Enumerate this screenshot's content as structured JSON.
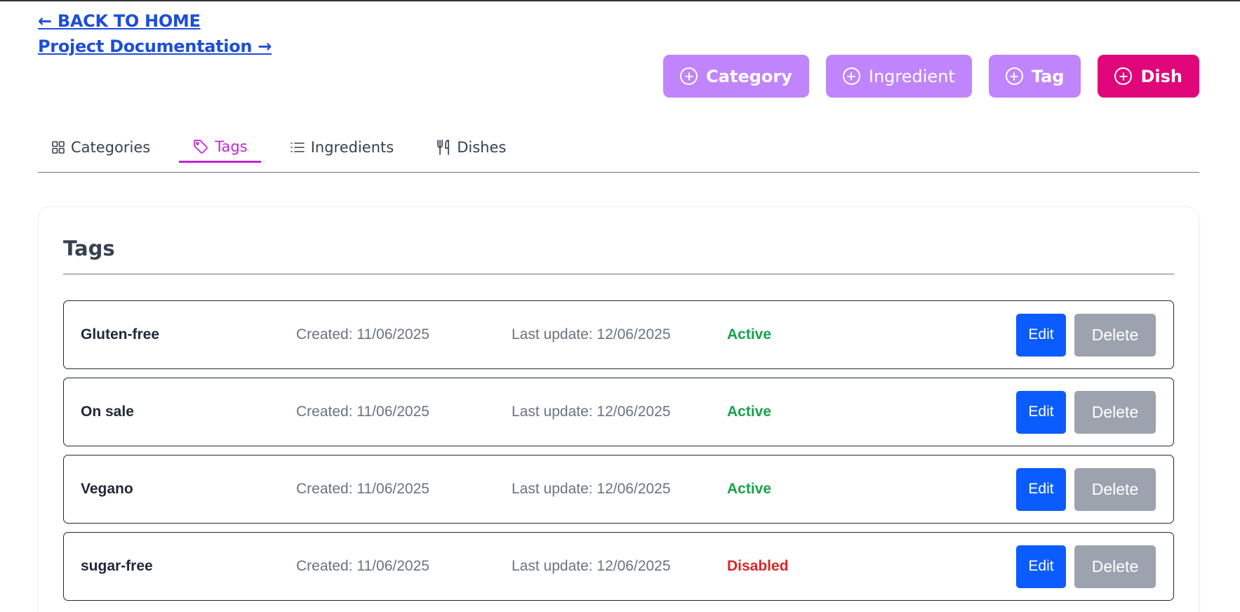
{
  "nav": {
    "back_home": "← BACK TO HOME",
    "project_docs": "Project Documentation →"
  },
  "actions": [
    {
      "label": "Category",
      "icon": "plus-circle-icon"
    },
    {
      "label": "Ingredient",
      "icon": "plus-circle-icon"
    },
    {
      "label": "Tag",
      "icon": "plus-circle-icon"
    },
    {
      "label": "Dish",
      "icon": "plus-circle-icon"
    }
  ],
  "tabs": [
    {
      "label": "Categories",
      "icon": "grid-icon"
    },
    {
      "label": "Tags",
      "icon": "tag-icon",
      "active": true
    },
    {
      "label": "Ingredients",
      "icon": "list-icon"
    },
    {
      "label": "Dishes",
      "icon": "utensils-icon"
    }
  ],
  "section": {
    "title": "Tags"
  },
  "tags": [
    {
      "name": "Gluten-free",
      "created": "Created: 11/06/2025",
      "updated": "Last update: 12/06/2025",
      "status": "Active"
    },
    {
      "name": "On sale",
      "created": "Created: 11/06/2025",
      "updated": "Last update: 12/06/2025",
      "status": "Active"
    },
    {
      "name": "Vegano",
      "created": "Created: 11/06/2025",
      "updated": "Last update: 12/06/2025",
      "status": "Active"
    },
    {
      "name": "sugar-free",
      "created": "Created: 11/06/2025",
      "updated": "Last update: 12/06/2025",
      "status": "Disabled"
    }
  ],
  "row_buttons": {
    "edit": "Edit",
    "delete": "Delete"
  },
  "colors": {
    "accent": "#c084fc",
    "dish_button": "#e0067a",
    "active_tab": "#c026d3",
    "edit_button": "#0b5cff",
    "delete_button": "#9ca3af",
    "status_active": "#16a34a",
    "status_disabled": "#dc2626"
  }
}
